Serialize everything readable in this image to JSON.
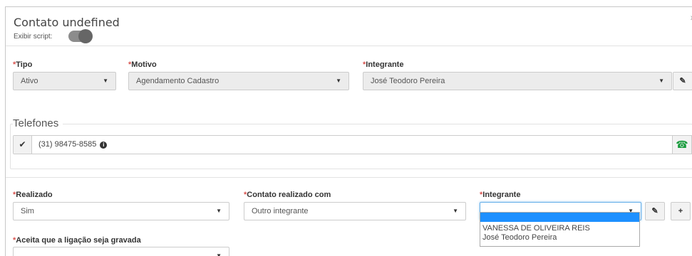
{
  "header": {
    "title": "Contato undefined",
    "script_label": "Exibir script:",
    "close": "x"
  },
  "row1": {
    "tipo_label": "Tipo",
    "tipo_value": "Ativo",
    "motivo_label": "Motivo",
    "motivo_value": "Agendamento Cadastro",
    "integrante_label": "Integrante",
    "integrante_value": "José Teodoro Pereira"
  },
  "telefones": {
    "legend": "Telefones",
    "phone": "(31) 98475-8585",
    "info": "i"
  },
  "row2": {
    "realizado_label": "Realizado",
    "realizado_value": "Sim",
    "contato_label": "Contato realizado com",
    "contato_value": "Outro integrante",
    "integrante_label": "Integrante",
    "integrante_value": ""
  },
  "dropdown": {
    "options": [
      "",
      "VANESSA DE OLIVEIRA REIS",
      "José Teodoro Pereira"
    ]
  },
  "row3": {
    "aceita_label": "Aceita que a ligação seja gravada",
    "aceita_value": ""
  },
  "required_mark": "*",
  "caret": "▼",
  "edit_glyph": "✎",
  "plus_glyph": "+",
  "check_glyph": "✔",
  "phone_glyph": "☎",
  "colors": {
    "required": "#d9534f",
    "accent": "#1e90ff",
    "phone_green": "#1a9c3e"
  }
}
